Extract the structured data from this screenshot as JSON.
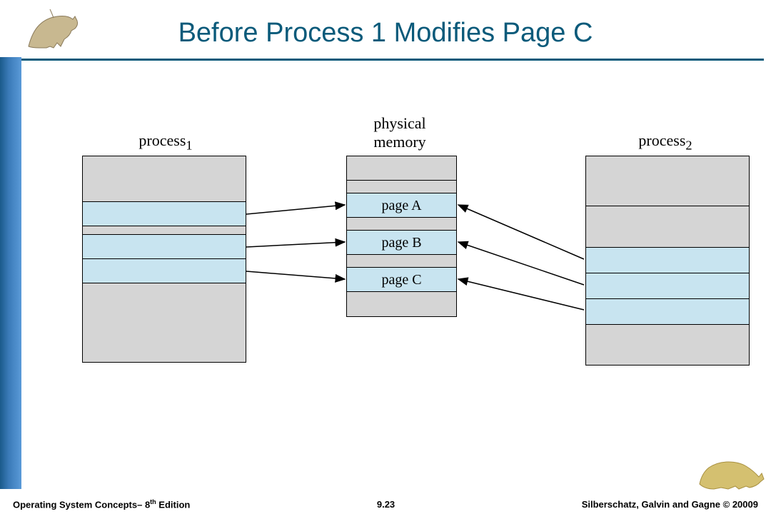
{
  "title": "Before Process 1 Modifies Page C",
  "labels": {
    "process1": "process",
    "process1_sub": "1",
    "physical": "physical\nmemory",
    "process2": "process",
    "process2_sub": "2"
  },
  "pages": {
    "a": "page A",
    "b": "page B",
    "c": "page C"
  },
  "footer": {
    "left_pre": "Operating System Concepts– 8",
    "left_sup": "th",
    "left_post": " Edition",
    "page": "9.23",
    "right": "Silberschatz, Galvin and Gagne © 20009"
  }
}
